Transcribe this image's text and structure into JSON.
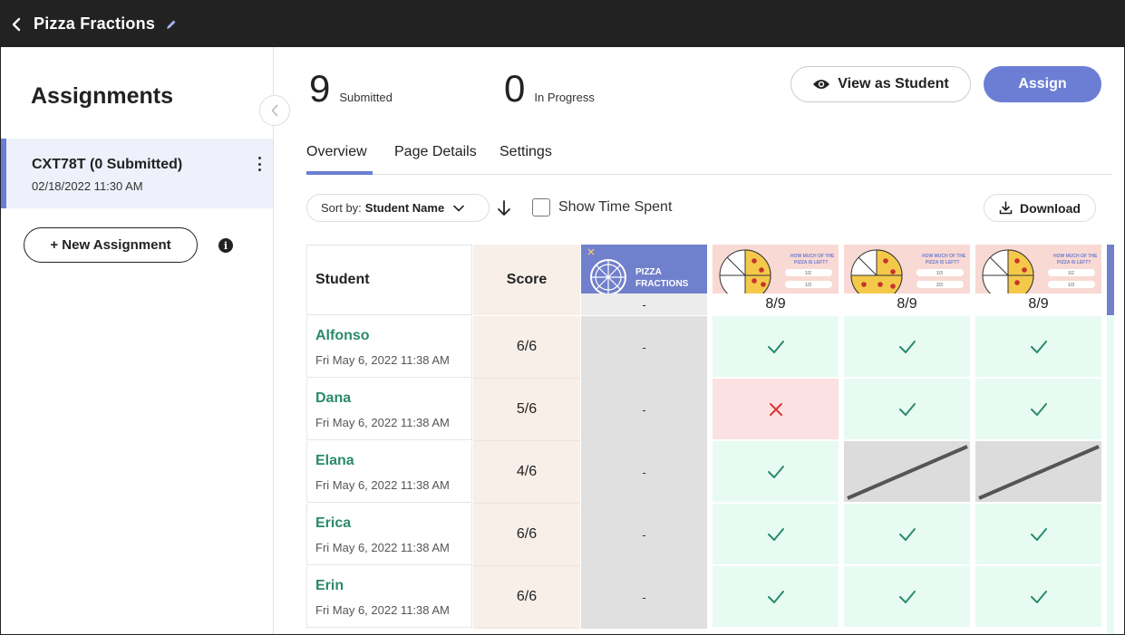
{
  "topbar": {
    "title": "Pizza Fractions"
  },
  "sidebar": {
    "heading": "Assignments",
    "assignment": {
      "name": "CXT78T (0 Submitted)",
      "date": "02/18/2022 11:30 AM"
    },
    "new_button": "+ New Assignment",
    "info": "i"
  },
  "stats": {
    "submitted_count": "9",
    "submitted_label": "Submitted",
    "progress_count": "0",
    "progress_label": "In Progress"
  },
  "actions": {
    "view_as_student": "View as Student",
    "assign": "Assign",
    "download": "Download"
  },
  "tabs": [
    {
      "label": "Overview"
    },
    {
      "label": "Page Details"
    },
    {
      "label": "Settings"
    }
  ],
  "controls": {
    "sort_prefix": "Sort by:",
    "sort_value": "Student Name",
    "show_time_label": "Show Time Spent"
  },
  "table": {
    "student_header": "Student",
    "score_header": "Score",
    "pages": [
      {
        "kind": "cover",
        "title_line1": "PIZZA",
        "title_line2": "FRACTIONS",
        "score": "-"
      },
      {
        "kind": "question",
        "question": "HOW MUCH OF THE PIZZA IS LEFT?",
        "opt1": "1/2",
        "opt2": "1/3",
        "score": "8/9"
      },
      {
        "kind": "question",
        "question": "HOW MUCH OF THE PIZZA IS LEFT?",
        "opt1": "1/3",
        "opt2": "2/3",
        "score": "8/9"
      },
      {
        "kind": "question",
        "question": "HOW MUCH OF THE PIZZA IS LEFT?",
        "opt1": "1/2",
        "opt2": "1/3",
        "score": "8/9"
      }
    ],
    "rows": [
      {
        "name": "Alfonso",
        "date": "Fri May 6, 2022  11:38 AM",
        "score": "6/6",
        "cover": "-",
        "cells": [
          "correct",
          "correct",
          "correct"
        ]
      },
      {
        "name": "Dana",
        "date": "Fri May 6, 2022  11:38 AM",
        "score": "5/6",
        "cover": "-",
        "cells": [
          "wrong",
          "correct",
          "correct"
        ]
      },
      {
        "name": "Elana",
        "date": "Fri May 6, 2022  11:38 AM",
        "score": "4/6",
        "cover": "-",
        "cells": [
          "correct",
          "blank",
          "blank"
        ]
      },
      {
        "name": "Erica",
        "date": "Fri May 6, 2022  11:38 AM",
        "score": "6/6",
        "cover": "-",
        "cells": [
          "correct",
          "correct",
          "correct"
        ]
      },
      {
        "name": "Erin",
        "date": "Fri May 6, 2022  11:38 AM",
        "score": "6/6",
        "cover": "-",
        "cells": [
          "correct",
          "correct",
          "correct"
        ]
      }
    ]
  },
  "colors": {
    "accent": "#6b7ed4",
    "correct_bg": "#e7fbf2",
    "wrong_bg": "#fbe1e1",
    "check": "#2a8a6c",
    "cross": "#d93636",
    "score_bg": "#f8efe9"
  },
  "icons": {
    "back": "chevron-left-icon",
    "edit": "pencil-icon",
    "kebab": "more-vertical-icon",
    "collapse": "chevron-left-icon",
    "view": "eye-icon",
    "sort_open": "chevron-down-icon",
    "sort_direction": "arrow-down-icon",
    "download": "download-icon",
    "correct": "check-icon",
    "wrong": "x-icon",
    "blank": "no-response-icon"
  }
}
